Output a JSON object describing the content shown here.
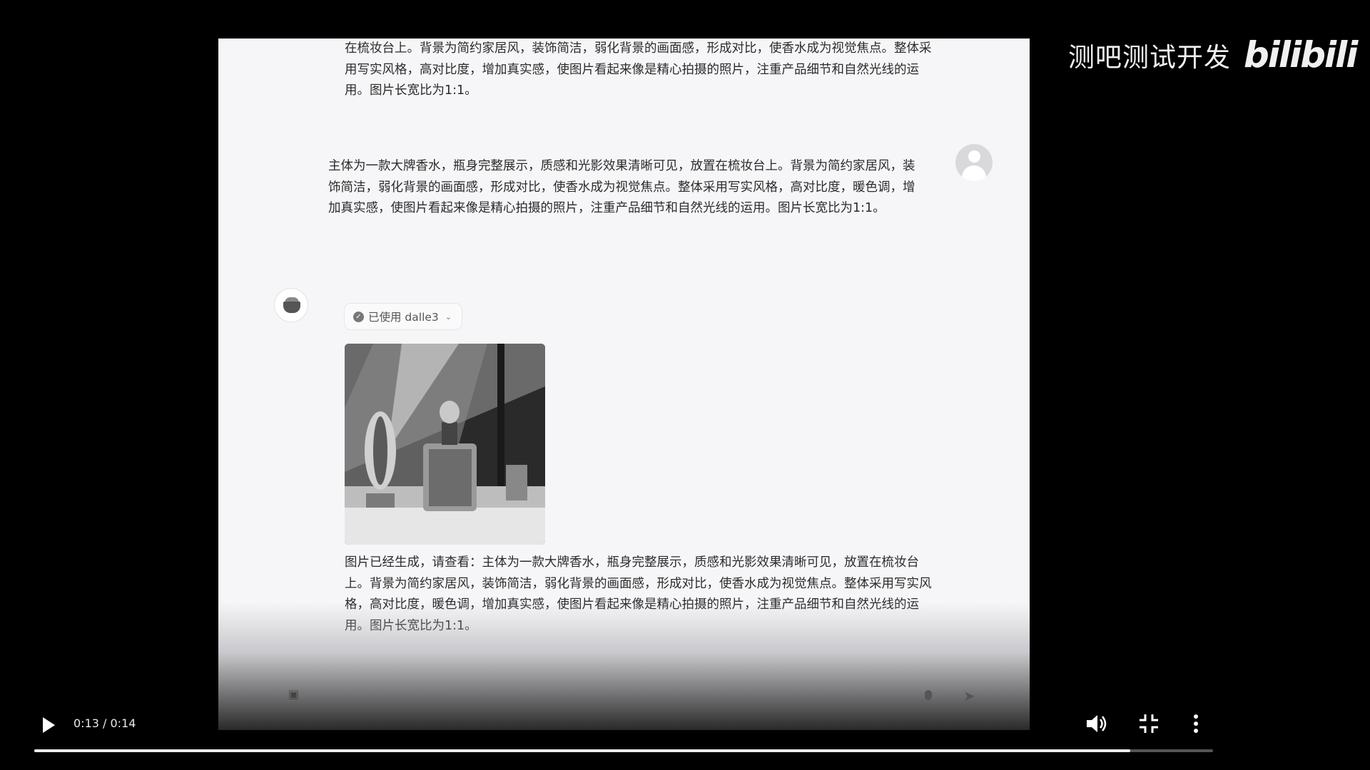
{
  "watermark": {
    "channel": "测吧测试开发",
    "logo": "bilibili"
  },
  "chat": {
    "partial_reply": "在梳妆台上。背景为简约家居风，装饰简洁，弱化背景的画面感，形成对比，使香水成为视觉焦点。整体采用写实风格，高对比度，增加真实感，使图片看起来像是精心拍摄的照片，注重产品细节和自然光线的运用。图片长宽比为1:1。",
    "user_message": "主体为一款大牌香水，瓶身完整展示，质感和光影效果清晰可见，放置在梳妆台上。背景为简约家居风，装饰简洁，弱化背景的画面感，形成对比，使香水成为视觉焦点。整体采用写实风格，高对比度，暖色调，增加真实感，使图片看起来像是精心拍摄的照片，注重产品细节和自然光线的运用。图片长宽比为1:1。",
    "tool_label": "已使用 dalle3",
    "assistant_reply": "图片已经生成，请查看：主体为一款大牌香水，瓶身完整展示，质感和光影效果清晰可见，放置在梳妆台上。背景为简约家居风，装饰简洁，弱化背景的画面感，形成对比，使香水成为视觉焦点。整体采用写实风格，高对比度，暖色调，增加真实感，使图片看起来像是精心拍摄的照片，注重产品细节和自然光线的运用。图片长宽比为1:1。"
  },
  "player": {
    "time": "0:13 / 0:14",
    "progress_fraction": 0.93
  }
}
